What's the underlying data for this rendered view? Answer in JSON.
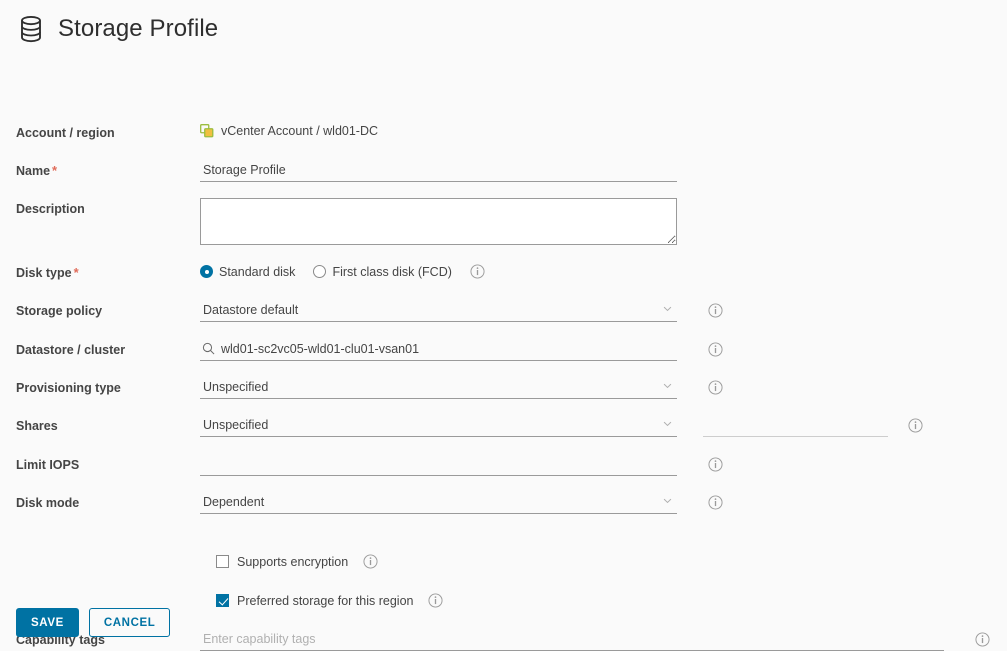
{
  "header": {
    "title": "Storage Profile",
    "icon": "database-icon"
  },
  "form": {
    "account_region": {
      "label": "Account / region",
      "value": "vCenter Account / wld01-DC",
      "icon": "vcenter-endpoint-icon"
    },
    "name": {
      "label": "Name",
      "required_marker": "*",
      "value": "Storage Profile"
    },
    "description": {
      "label": "Description",
      "value": "",
      "placeholder": ""
    },
    "disk_type": {
      "label": "Disk type",
      "required_marker": "*",
      "options": [
        {
          "label": "Standard disk",
          "selected": true
        },
        {
          "label": "First class disk (FCD)",
          "selected": false
        }
      ]
    },
    "storage_policy": {
      "label": "Storage policy",
      "value": "Datastore default"
    },
    "datastore_cluster": {
      "label": "Datastore / cluster",
      "value": "wld01-sc2vc05-wld01-clu01-vsan01",
      "icon": "search-icon"
    },
    "provisioning_type": {
      "label": "Provisioning type",
      "value": "Unspecified"
    },
    "shares": {
      "label": "Shares",
      "value": "Unspecified",
      "secondary_value": ""
    },
    "limit_iops": {
      "label": "Limit IOPS",
      "value": ""
    },
    "disk_mode": {
      "label": "Disk mode",
      "value": "Dependent"
    },
    "supports_encryption": {
      "label": "Supports encryption",
      "checked": false
    },
    "preferred_storage": {
      "label": "Preferred storage for this region",
      "checked": true
    },
    "capability_tags": {
      "label": "Capability tags",
      "value": "",
      "placeholder": "Enter capability tags"
    }
  },
  "actions": {
    "save_label": "SAVE",
    "cancel_label": "CANCEL"
  },
  "colors": {
    "accent": "#0072a3",
    "required": "#e06c5a",
    "background": "#fafafa",
    "label_text": "#454545",
    "endpoint_icon": "#9bbd3f"
  }
}
